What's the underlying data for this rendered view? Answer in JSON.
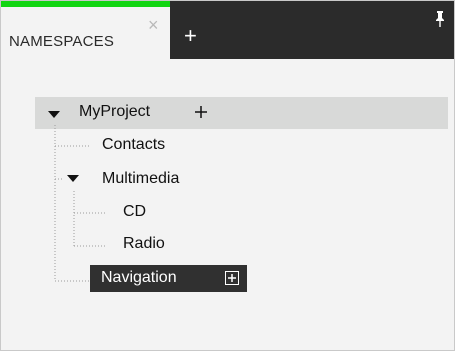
{
  "tabbar": {
    "active_tab_label": "NAMESPACES",
    "close_symbol": "×",
    "add_tab_symbol": "+",
    "pin_icon": "pin-icon",
    "active_tab_accent": "#12d512",
    "bar_color": "#2b2b2b"
  },
  "tree": {
    "root": {
      "label": "MyProject",
      "plus_symbol": "+"
    },
    "children": [
      {
        "label": "Contacts"
      },
      {
        "label": "Multimedia"
      },
      {
        "label": "CD"
      },
      {
        "label": "Radio"
      },
      {
        "label": "Navigation",
        "plus_symbol": "+"
      }
    ]
  }
}
